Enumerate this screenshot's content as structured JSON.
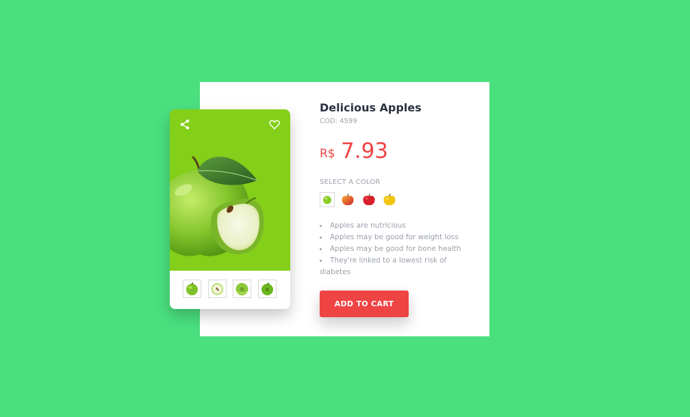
{
  "product": {
    "title": "Delicious Apples",
    "code": "COD: 4599",
    "currency": "R$",
    "price": "7.93"
  },
  "colors": {
    "label": "SELECT A COLOR",
    "options": [
      {
        "name": "green-apple",
        "color": "#8ccc2a",
        "selected": true
      },
      {
        "name": "red-yellow-apple",
        "color": "#e2572e",
        "selected": false
      },
      {
        "name": "red-apple",
        "color": "#d8202a",
        "selected": false
      },
      {
        "name": "yellow-apple",
        "color": "#f1c40f",
        "selected": false
      }
    ]
  },
  "features": [
    "Apples are nutricious",
    "Apples may be good for weight loss",
    "Apples may be good for bone health",
    "They're linked to a lowest risk of diabetes"
  ],
  "actions": {
    "add_to_cart": "ADD TO CART"
  },
  "card": {
    "image_background": "#83cf19",
    "icons": [
      "share-icon",
      "heart-icon"
    ],
    "thumbnails": [
      "whole-apple",
      "apple-slice",
      "apple-top",
      "apple-side"
    ]
  },
  "theme": {
    "background": "#4ae07e",
    "accent": "#ef4444"
  }
}
